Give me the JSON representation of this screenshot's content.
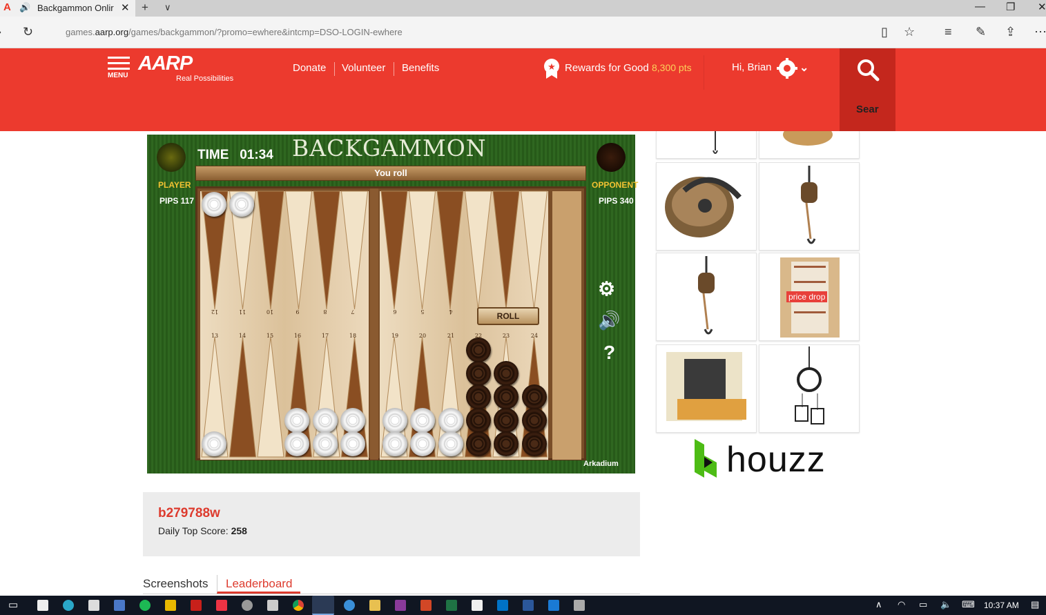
{
  "browser": {
    "tab_title": "Backgammon Onlir",
    "url_prefix": "games.",
    "url_domain": "aarp.org",
    "url_rest": "/games/backgammon/?promo=ewhere&intcmp=DSO-LOGIN-ewhere"
  },
  "header": {
    "menu_label": "MENU",
    "logo": "AARP",
    "tagline": "Real Possibilities",
    "nav": [
      "Donate",
      "Volunteer",
      "Benefits"
    ],
    "rewards_label": "Rewards for Good",
    "rewards_points": "8,300 pts",
    "greeting": "Hi, Brian",
    "search_label": "Sear"
  },
  "game": {
    "title": "BACKGAMMON",
    "time_label": "TIME",
    "time_value": "01:34",
    "banner": "You roll",
    "player_label": "PLAYER",
    "player_pips": "PIPS 117",
    "opponent_label": "OPPONENT",
    "opponent_pips": "PIPS 340",
    "roll_button": "ROLL",
    "help_glyph": "?",
    "brand": "Arkadium",
    "top_point_numbers": [
      "12",
      "11",
      "10",
      "9",
      "8",
      "7",
      "6",
      "5",
      "4"
    ],
    "bottom_point_numbers": [
      "13",
      "14",
      "15",
      "16",
      "17",
      "18",
      "19",
      "20",
      "21",
      "22",
      "23",
      "24"
    ]
  },
  "ads": {
    "price_drop_badge": "price drop",
    "brand": "houzz"
  },
  "score": {
    "username": "b279788w",
    "daily_label": "Daily Top Score:",
    "daily_value": "258"
  },
  "tabs": [
    "Screenshots",
    "Leaderboard"
  ],
  "taskbar": {
    "time": "10:37 AM"
  },
  "colors": {
    "brand_red": "#ec3a2e",
    "rewards_points": "#fcd25a",
    "felt_green": "#2a5e1c"
  }
}
